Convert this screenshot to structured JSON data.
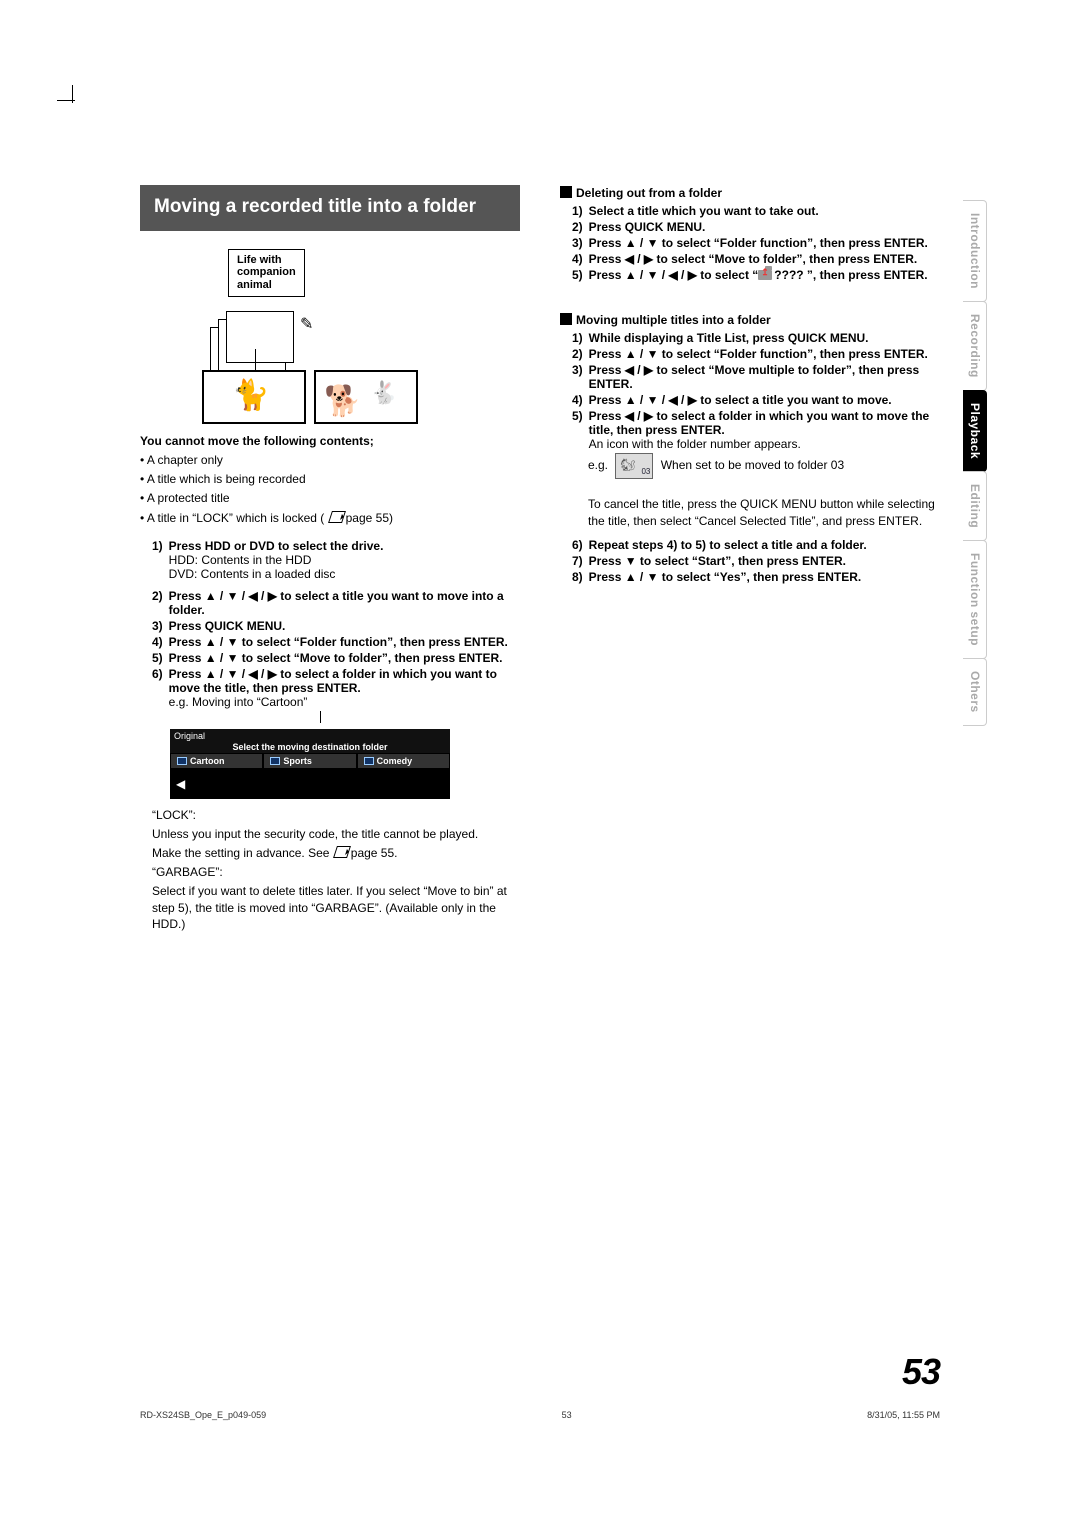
{
  "page_number": "53",
  "tabs": [
    "Introduction",
    "Recording",
    "Playback",
    "Editing",
    "Function setup",
    "Others"
  ],
  "active_tab_index": 2,
  "footer": {
    "left": "RD-XS24SB_Ope_E_p049-059",
    "center": "53",
    "right": "8/31/05, 11:55 PM"
  },
  "left": {
    "section_title": "Moving a recorded title into a folder",
    "folder_label": "Life with\ncompanion\nanimal",
    "cannot_heading": "You cannot move the following contents;",
    "cannot_items": [
      "A chapter only",
      "A title which is being recorded",
      "A protected title",
      "A title in “LOCK” which is locked (  page 55)"
    ],
    "page55_ref": "page 55",
    "steps": [
      {
        "n": "1)",
        "bold": "Press HDD or DVD to select the drive.",
        "sub": [
          "HDD: Contents in the HDD",
          "DVD: Contents in a loaded disc"
        ]
      },
      {
        "n": "2)",
        "bold": "Press ▲ / ▼ / ◀ / ▶ to select a title you want to move into a folder."
      },
      {
        "n": "3)",
        "bold": "Press QUICK MENU."
      },
      {
        "n": "4)",
        "bold": "Press ▲ / ▼ to select “Folder function”, then press ENTER."
      },
      {
        "n": "5)",
        "bold": "Press ▲ / ▼ to select “Move to folder”, then press ENTER."
      },
      {
        "n": "6)",
        "bold": "Press ▲ / ▼ / ◀ / ▶ to select a folder in which you want to move the title, then press ENTER.",
        "sub": [
          "e.g. Moving into “Cartoon”"
        ]
      }
    ],
    "mini_ui": {
      "corner": "Original",
      "header": "Select the moving destination folder",
      "cells": [
        "Cartoon",
        "Sports",
        "Comedy"
      ]
    },
    "lock_head": "“LOCK”:",
    "lock_body": "Unless you input the security code, the title cannot be played.",
    "lock_see": "Make the setting in advance. See  page 55.",
    "garbage_head": "“GARBAGE”:",
    "garbage_body": "Select if you want to delete titles later. If you select “Move to bin” at step 5), the title is moved into “GARBAGE”. (Available only in the HDD.)"
  },
  "right": {
    "del_head": "Deleting out from a folder",
    "del_steps": [
      {
        "n": "1)",
        "bold": "Select a title which you want to take out."
      },
      {
        "n": "2)",
        "bold": "Press QUICK MENU."
      },
      {
        "n": "3)",
        "bold": "Press ▲ / ▼ to select “Folder function”, then press ENTER."
      },
      {
        "n": "4)",
        "bold": "Press ◀ / ▶ to select “Move to folder”, then press ENTER."
      },
      {
        "n": "5)",
        "bold": "Press ▲ / ▼ / ◀ / ▶  to select “ ???? ”, then press ENTER.",
        "icon_after_quote": true
      }
    ],
    "multi_head": "Moving multiple titles into a folder",
    "multi_steps": [
      {
        "n": "1)",
        "bold": "While displaying a Title List, press QUICK MENU."
      },
      {
        "n": "2)",
        "bold": "Press ▲ / ▼ to select “Folder function”, then press ENTER."
      },
      {
        "n": "3)",
        "bold": "Press ◀ / ▶ to select “Move multiple to folder”, then press ENTER."
      },
      {
        "n": "4)",
        "bold": "Press ▲ / ▼ / ◀ / ▶ to select a title you want to move."
      },
      {
        "n": "5)",
        "bold": "Press ◀ / ▶ to select a folder in which you want to move the title, then press ENTER.",
        "sub": [
          "An icon with the folder number appears."
        ]
      }
    ],
    "eg_prefix": "e.g.",
    "eg_suffix": "When set to be moved to folder 03",
    "cancel_para": "To cancel the title, press the QUICK MENU button while selecting the title, then select “Cancel Selected Title”, and press ENTER.",
    "tail_steps": [
      {
        "n": "6)",
        "bold": "Repeat steps 4) to 5) to select a title and a folder."
      },
      {
        "n": "7)",
        "bold": "Press ▼ to select “Start”, then press ENTER."
      },
      {
        "n": "8)",
        "bold": "Press ▲ / ▼ to select “Yes”, then press ENTER."
      }
    ]
  }
}
